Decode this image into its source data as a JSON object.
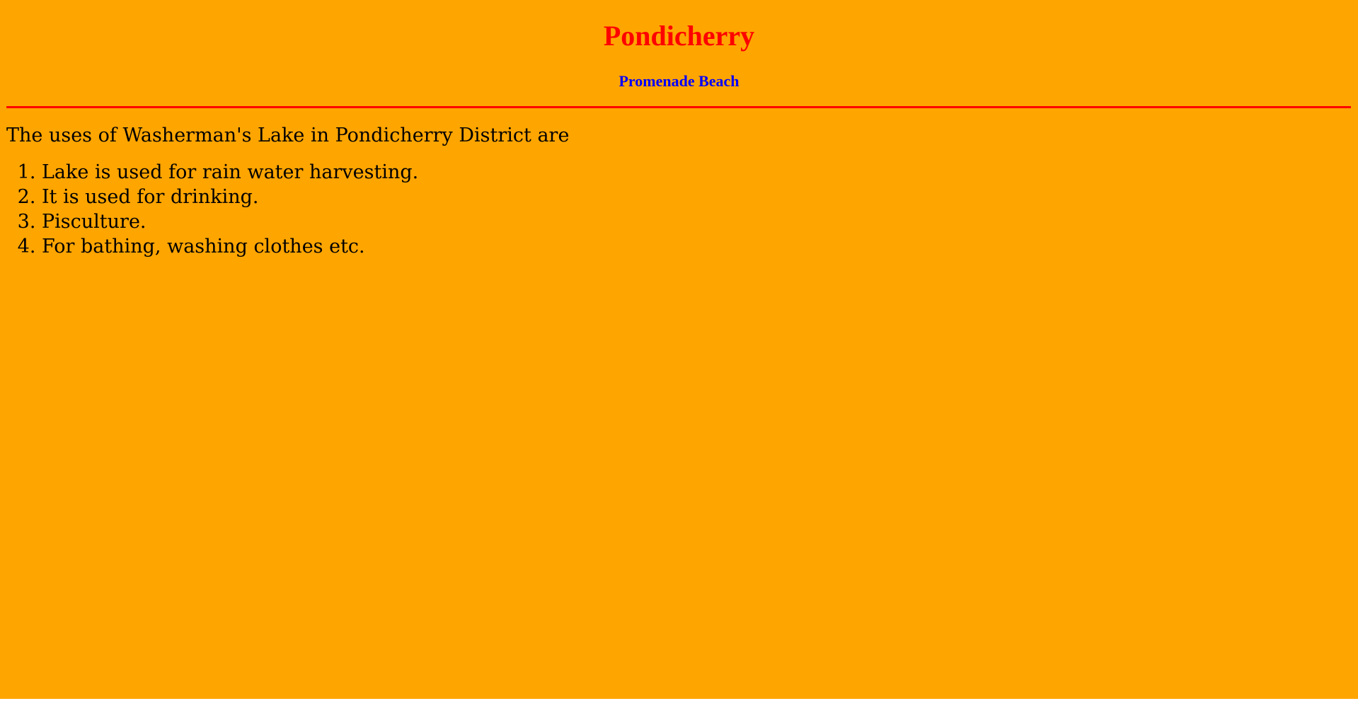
{
  "header": {
    "title": "Pondicherry",
    "subtitle": "Promenade Beach"
  },
  "content": {
    "intro": "The uses of Washerman's Lake in Pondicherry District are",
    "uses": [
      "Lake is used for rain water harvesting.",
      "It is used for drinking.",
      "Pisculture.",
      "For bathing, washing clothes etc."
    ]
  },
  "colors": {
    "background": "#FFA500",
    "title": "#FF0000",
    "subtitle": "#0000FF",
    "rule": "#FF0000"
  }
}
